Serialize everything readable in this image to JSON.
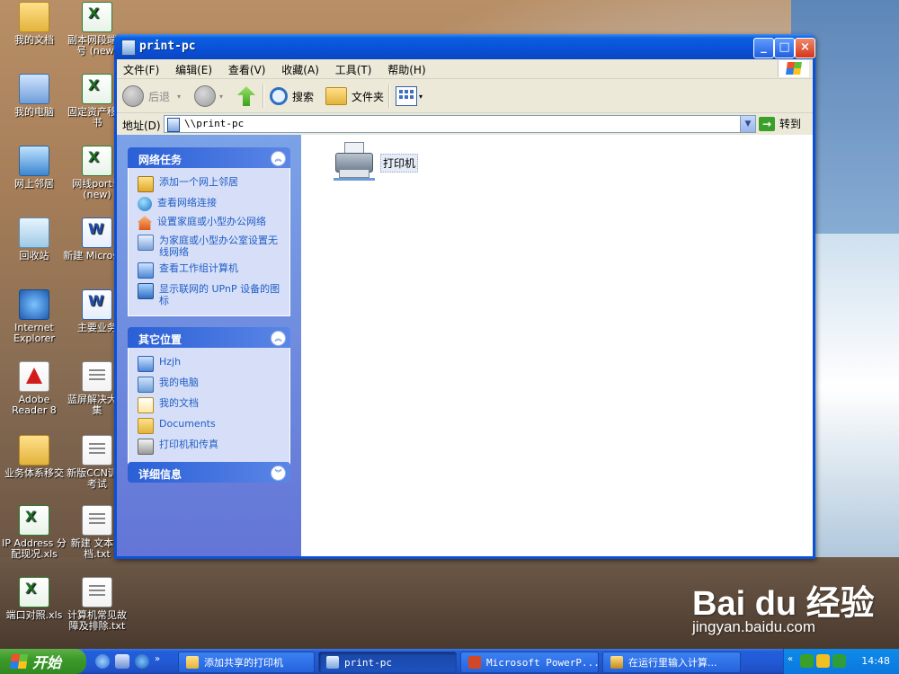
{
  "desktop": {
    "icons": [
      {
        "label": "我的文档"
      },
      {
        "label": "我的电脑"
      },
      {
        "label": "网上邻居"
      },
      {
        "label": "回收站"
      },
      {
        "label": "Internet Explorer"
      },
      {
        "label": "Adobe Reader 8"
      },
      {
        "label": "业务体系移交"
      },
      {
        "label": "IP Address 分配现况.xls"
      },
      {
        "label": "端口对照.xls"
      },
      {
        "label": "副本网段端口号 (new)"
      },
      {
        "label": "固定资产移交书"
      },
      {
        "label": "网线port号(new)"
      },
      {
        "label": "新建 Microsoft"
      },
      {
        "label": "主要业务"
      },
      {
        "label": "蓝屏解决大合集"
      },
      {
        "label": "新版CCN训、考试"
      },
      {
        "label": "新建 文本文档.txt"
      },
      {
        "label": "计算机常见故障及排除.txt"
      }
    ]
  },
  "window": {
    "title": "print-pc",
    "menu": [
      "文件(F)",
      "编辑(E)",
      "查看(V)",
      "收藏(A)",
      "工具(T)",
      "帮助(H)"
    ],
    "toolbar": {
      "back_label": "后退",
      "search_label": "搜索",
      "folders_label": "文件夹"
    },
    "address": {
      "label": "地址(D)",
      "value": "\\\\print-pc",
      "go_label": "转到"
    },
    "panels": {
      "network_tasks": {
        "title": "网络任务",
        "items": [
          {
            "label": "添加一个网上邻居",
            "icon": "add-network-place-icon"
          },
          {
            "label": "查看网络连接",
            "icon": "network-connections-icon"
          },
          {
            "label": "设置家庭或小型办公网络",
            "icon": "home-network-icon"
          },
          {
            "label": "为家庭或小型办公室设置无线网络",
            "icon": "wireless-network-icon"
          },
          {
            "label": "查看工作组计算机",
            "icon": "workgroup-icon"
          },
          {
            "label": "显示联网的 UPnP 设备的图标",
            "icon": "upnp-icon"
          }
        ]
      },
      "other_places": {
        "title": "其它位置",
        "items": [
          {
            "label": "Hzjh",
            "icon": "network-computer-icon"
          },
          {
            "label": "我的电脑",
            "icon": "my-computer-icon"
          },
          {
            "label": "我的文档",
            "icon": "my-documents-icon"
          },
          {
            "label": "Documents",
            "icon": "folder-icon"
          },
          {
            "label": "打印机和传真",
            "icon": "printers-faxes-icon"
          }
        ]
      },
      "details": {
        "title": "详细信息"
      }
    },
    "content": {
      "items": [
        {
          "label": "打印机",
          "icon": "printer-folder-icon"
        }
      ]
    }
  },
  "taskbar": {
    "start_label": "开始",
    "tasks": [
      {
        "label": "添加共享的打印机",
        "active": false
      },
      {
        "label": "print-pc",
        "active": true
      },
      {
        "label": "Microsoft PowerP...",
        "active": false
      },
      {
        "label": "在运行里输入计算...",
        "active": false
      }
    ],
    "clock": "14:48"
  },
  "watermark": {
    "brand": "Bai du 经验",
    "url": "jingyan.baidu.com"
  }
}
